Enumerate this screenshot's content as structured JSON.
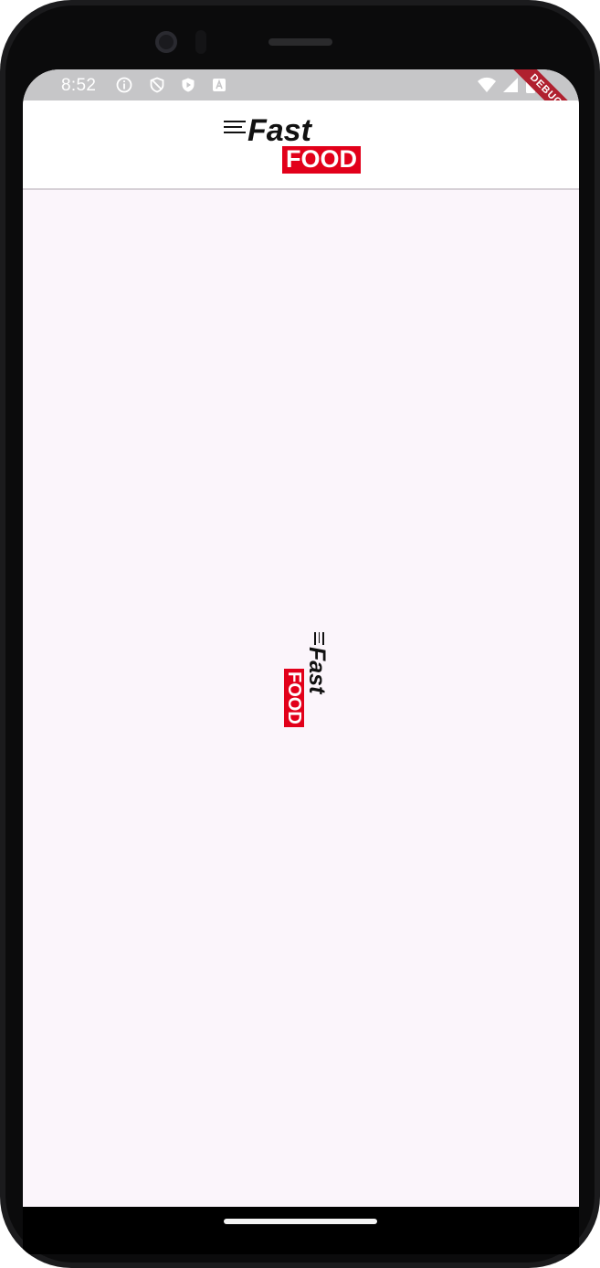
{
  "status_bar": {
    "time": "8:52",
    "left_icons": [
      "info-icon",
      "shield-icon",
      "play-protect-icon",
      "a-icon"
    ],
    "right_icons": [
      "wifi-icon",
      "signal-icon",
      "battery-icon"
    ]
  },
  "debug_banner": "DEBUG",
  "app_bar": {
    "logo": {
      "word1": "Fast",
      "word2": "FOOD"
    }
  },
  "center_logo": {
    "word1": "Fast",
    "word2": "FOOD",
    "rotation_deg": 90
  },
  "colors": {
    "brand_red": "#e2001a",
    "screen_bg": "#fbf5fb",
    "status_bar_bg": "#c6c6c8"
  }
}
